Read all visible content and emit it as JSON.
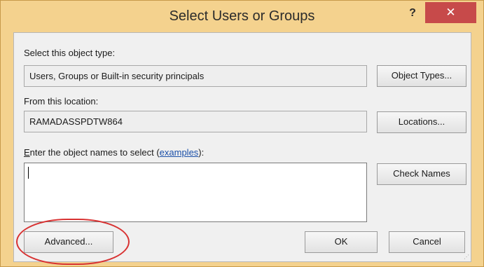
{
  "dialog": {
    "title": "Select Users or Groups",
    "help_glyph": "?",
    "close_glyph": "✕"
  },
  "object_type": {
    "label": "Select this object type:",
    "value": "Users, Groups or Built-in security principals",
    "button": "Object Types..."
  },
  "location": {
    "label": "From this location:",
    "value": "RAMADASSPDTW864",
    "button": "Locations..."
  },
  "object_names": {
    "label_prefix_underlined": "E",
    "label_main": "nter the object names to select (",
    "link_text": "examples",
    "label_suffix": "):",
    "value": "",
    "check_button": "Check Names"
  },
  "footer": {
    "advanced_button": "Advanced...",
    "ok_button": "OK",
    "cancel_button": "Cancel"
  },
  "colors": {
    "frame": "#f4d28e",
    "close_button": "#c74a4a",
    "client_bg": "#f0f0f0",
    "annotation": "#d83232",
    "link": "#1a4fa8"
  },
  "icons": {
    "help": "help-icon",
    "close": "close-icon",
    "resize": "resize-grip-icon"
  }
}
